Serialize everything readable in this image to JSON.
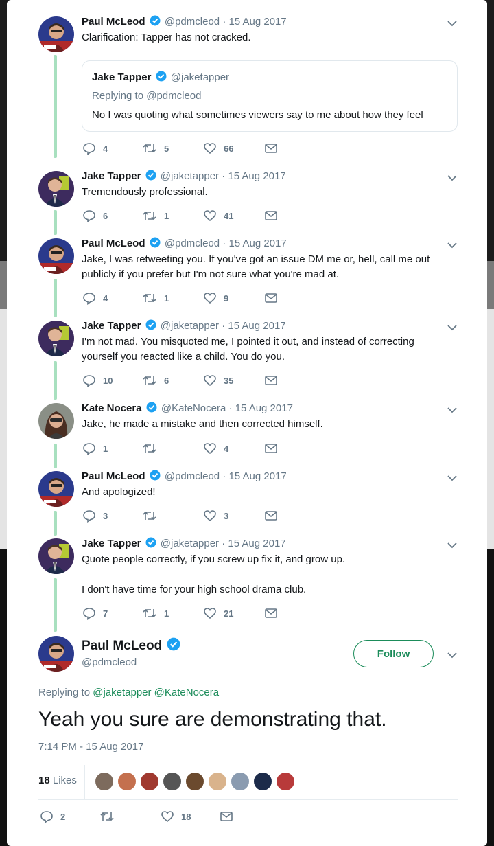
{
  "colors": {
    "accent": "#1b8c5a",
    "thread_line": "#a8e0bf",
    "verified": "#1da1f2",
    "muted": "#657786"
  },
  "tweets": [
    {
      "name": "Paul McLeod",
      "handle": "@pdmcleod",
      "date": "· 15 Aug 2017",
      "text": "Clarification: Tapper has not cracked.",
      "replies": "4",
      "retweets": "5",
      "likes": "66",
      "quote": {
        "name": "Jake Tapper",
        "handle": "@jaketapper",
        "replying": "Replying to @pdmcleod",
        "text": "No I was quoting what sometimes viewers say to me about how they feel"
      }
    },
    {
      "name": "Jake Tapper",
      "handle": "@jaketapper",
      "date": "· 15 Aug 2017",
      "text": "Tremendously professional.",
      "replies": "6",
      "retweets": "1",
      "likes": "41"
    },
    {
      "name": "Paul McLeod",
      "handle": "@pdmcleod",
      "date": "· 15 Aug 2017",
      "text": "Jake, I was retweeting you. If you've got an issue DM me or, hell, call me out publicly if you prefer but I'm not sure what you're mad at.",
      "replies": "4",
      "retweets": "1",
      "likes": "9"
    },
    {
      "name": "Jake Tapper",
      "handle": "@jaketapper",
      "date": "· 15 Aug 2017",
      "text": "I'm not mad. You misquoted me, I pointed it out, and instead of correcting yourself you reacted like a child. You do you.",
      "replies": "10",
      "retweets": "6",
      "likes": "35"
    },
    {
      "name": "Kate Nocera",
      "handle": "@KateNocera",
      "date": "· 15 Aug 2017",
      "text": "Jake, he made a mistake and then corrected himself.",
      "replies": "1",
      "retweets": "",
      "likes": "4"
    },
    {
      "name": "Paul McLeod",
      "handle": "@pdmcleod",
      "date": "· 15 Aug 2017",
      "text": "And apologized!",
      "replies": "3",
      "retweets": "",
      "likes": "3"
    },
    {
      "name": "Jake Tapper",
      "handle": "@jaketapper",
      "date": "· 15 Aug 2017",
      "text": "Quote people correctly, if you screw up fix it, and grow up.",
      "text2": "I don't have time for your high school drama club.",
      "replies": "7",
      "retweets": "1",
      "likes": "21"
    }
  ],
  "main": {
    "name": "Paul McLeod",
    "handle": "@pdmcleod",
    "follow_label": "Follow",
    "replying_prefix": "Replying to",
    "reply_to": [
      "@jaketapper",
      "@KateNocera"
    ],
    "text": "Yeah you sure are demonstrating that.",
    "timestamp": "7:14 PM - 15 Aug 2017",
    "likes_count": "18",
    "likes_label": "Likes",
    "liker_colors": [
      "#7d6b5d",
      "#c4704e",
      "#a0392f",
      "#555555",
      "#6b4a2e",
      "#d9b38c",
      "#8a9bb0",
      "#1c2b4a",
      "#b83a3a"
    ],
    "replies": "2",
    "retweets": "",
    "likes": "18"
  }
}
